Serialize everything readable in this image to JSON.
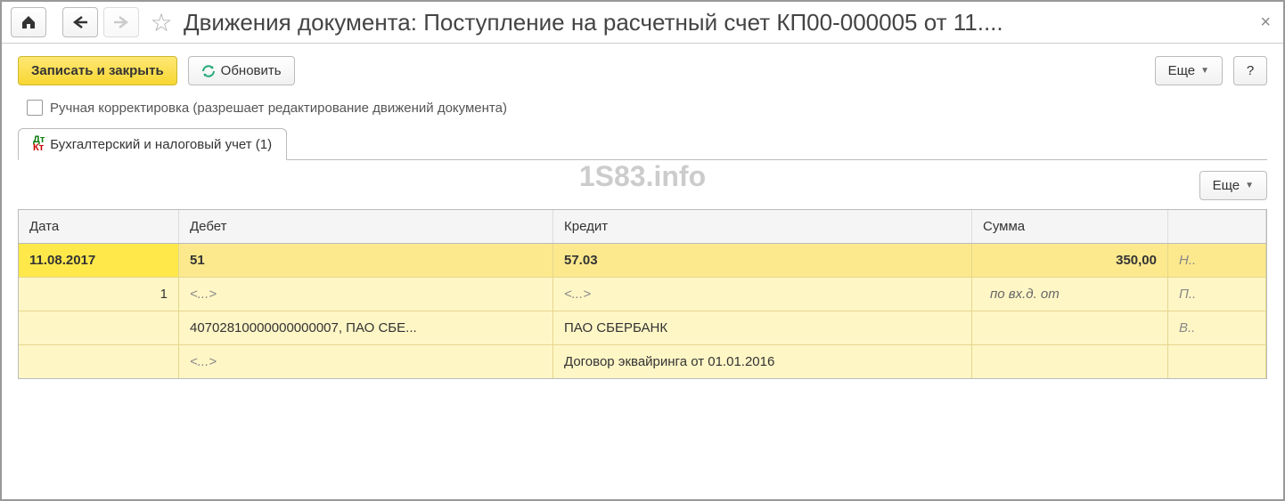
{
  "title": "Движения документа: Поступление на расчетный счет КП00-000005 от 11....",
  "toolbar": {
    "save_close": "Записать и закрыть",
    "refresh": "Обновить",
    "more": "Еще",
    "help": "?"
  },
  "checkbox_label": "Ручная корректировка (разрешает редактирование движений документа)",
  "tab_label": "Бухгалтерский и налоговый учет (1)",
  "watermark": "1S83.info",
  "more2": "Еще",
  "grid": {
    "headers": {
      "date": "Дата",
      "debit": "Дебет",
      "credit": "Кредит",
      "sum": "Сумма",
      "last": ""
    },
    "rows": [
      {
        "date": "11.08.2017",
        "debit": "51",
        "credit": "57.03",
        "sum": "350,00",
        "last": "Н..",
        "highlight": true,
        "bold": true
      },
      {
        "date": "1",
        "debit": "<...>",
        "credit": "<...>",
        "sum": "по вх.д.  от",
        "last": "П..",
        "date_align": "right",
        "italic_debit": true,
        "italic_credit": true,
        "italic_sum": true
      },
      {
        "date": "",
        "debit": "40702810000000000007, ПАО СБЕ...",
        "credit": "ПАО СБЕРБАНК",
        "sum": "",
        "last": "В.."
      },
      {
        "date": "",
        "debit": "<...>",
        "credit": "Договор эквайринга от 01.01.2016",
        "sum": "",
        "last": "",
        "italic_debit": true
      }
    ]
  }
}
